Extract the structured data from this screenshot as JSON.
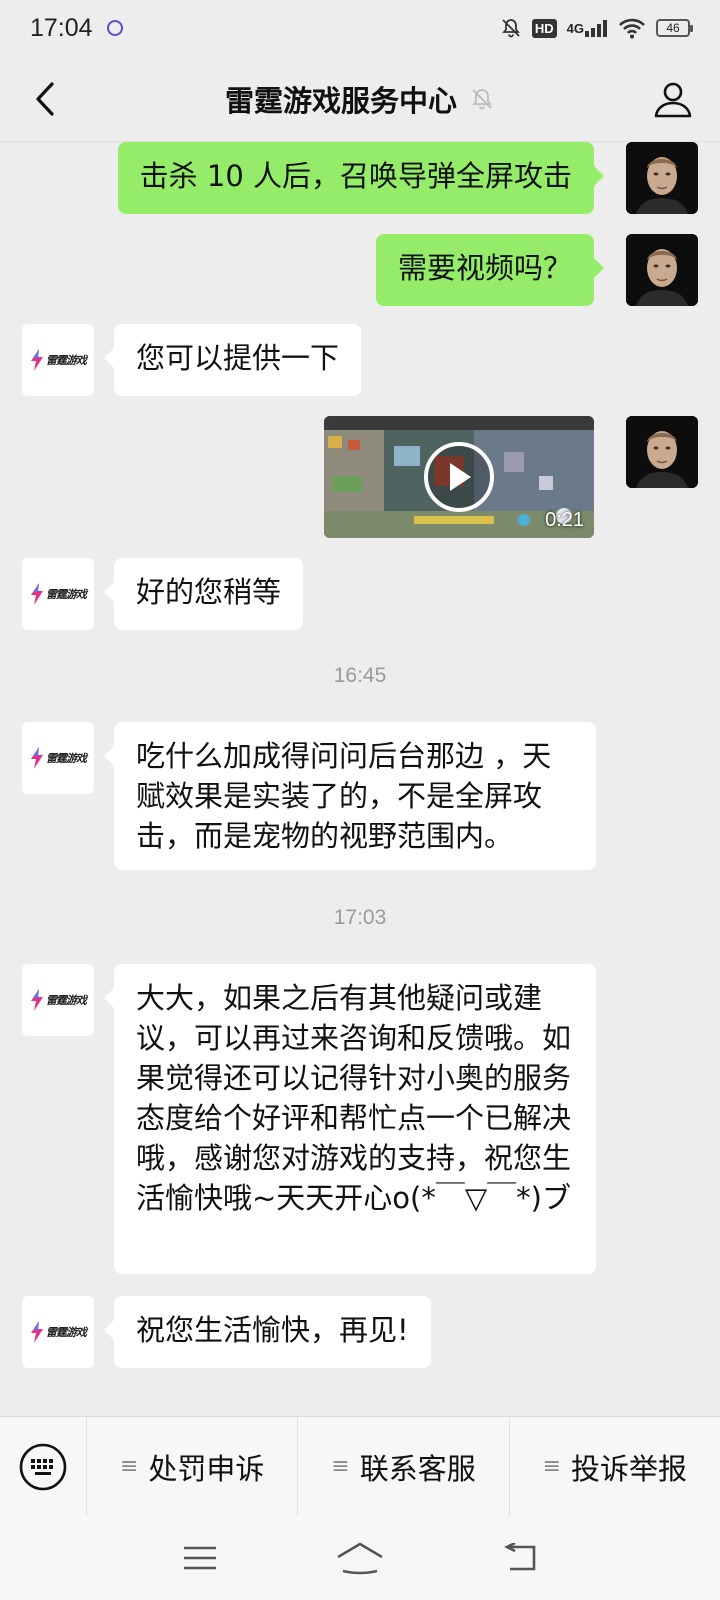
{
  "status_bar": {
    "time": "17:04",
    "hd": "HD",
    "network": "4G",
    "battery": "46"
  },
  "header": {
    "title": "雷霆游戏服务中心"
  },
  "bot": {
    "logo_text": "雷霆游戏"
  },
  "messages": {
    "m1": "击杀 10 人后，召唤导弹全屏攻击",
    "m2": "需要视频吗？",
    "m3": "您可以提供一下",
    "video_duration": "0:21",
    "m5": "好的您稍等",
    "ts1": "16:45",
    "m6": "吃什么加成得问问后台那边 ，天赋效果是实装了的，不是全屏攻击，而是宠物的视野范围内。",
    "ts2": "17:03",
    "m7": "大大，如果之后有其他疑问或建议，可以再过来咨询和反馈哦。如果觉得还可以记得针对小奥的服务态度给个好评和帮忙点一个已解决哦，感谢您对游戏的支持，祝您生活愉快哦~天天开心o(*￣▽￣*)ブ",
    "m8": "祝您生活愉快，再见!"
  },
  "menu": {
    "items": [
      {
        "label": "处罚申诉"
      },
      {
        "label": "联系客服"
      },
      {
        "label": "投诉举报"
      }
    ]
  }
}
